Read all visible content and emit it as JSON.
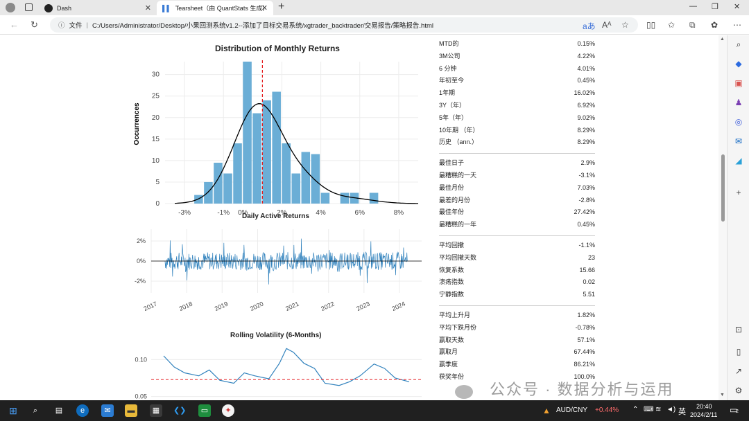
{
  "browser": {
    "tabs": [
      {
        "label": "Dash"
      },
      {
        "label": "Tearsheet（由 QuantStats 生成）"
      }
    ],
    "new_tab": "+",
    "address": {
      "prefix": "文件",
      "url": "C:/Users/Administrator/Desktop/小果回测系统v1.2--添加了目标交易系统/xgtrader_backtrader/交易报告/策略报告.html"
    }
  },
  "charts": {
    "monthly": {
      "title": "Distribution of Monthly Returns",
      "ylabel": "Occurrences",
      "yticks": [
        "0",
        "5",
        "10",
        "15",
        "20",
        "25",
        "30"
      ],
      "xticks": [
        "-3%",
        "-1%",
        "0%",
        "2%",
        "4%",
        "6%",
        "8%"
      ]
    },
    "daily": {
      "title": "Daily Active Returns",
      "yticks": [
        "2%",
        "0%",
        "-2%"
      ],
      "xticks": [
        "2017",
        "2018",
        "2019",
        "2020",
        "2021",
        "2022",
        "2023",
        "2024"
      ]
    },
    "volatility": {
      "title": "Rolling Volatility (6-Months)",
      "yticks": [
        "0.10",
        "0.05"
      ]
    }
  },
  "chart_data": [
    {
      "type": "bar",
      "title": "Distribution of Monthly Returns",
      "ylabel": "Occurrences",
      "xlabel": "",
      "x": [
        -2.5,
        -2.0,
        -1.5,
        -1.0,
        -0.5,
        0.0,
        0.5,
        1.0,
        1.5,
        2.0,
        2.5,
        3.0,
        3.5,
        4.0,
        4.5,
        5.0,
        5.5,
        6.0,
        6.5,
        7.0
      ],
      "values": [
        2,
        5,
        9.5,
        7,
        14,
        33,
        21,
        24,
        26,
        14,
        7,
        12,
        11.5,
        2.5,
        0,
        2.5,
        2.5,
        0,
        2.5,
        0
      ],
      "mean_line": 1.0,
      "ylim": [
        0,
        33
      ],
      "xlim": [
        -4,
        9
      ],
      "grid": true
    },
    {
      "type": "line",
      "title": "Daily Active Returns",
      "ylim": [
        -3,
        3
      ],
      "x_range": [
        2017,
        2024
      ],
      "grid": true
    },
    {
      "type": "line",
      "title": "Rolling Volatility (6-Months)",
      "x": [
        2017.0,
        2017.3,
        2017.6,
        2018.0,
        2018.3,
        2018.6,
        2019.0,
        2019.3,
        2019.6,
        2020.0,
        2020.3,
        2020.5,
        2020.7,
        2021.0,
        2021.3,
        2021.6,
        2022.0,
        2022.3,
        2022.6,
        2023.0,
        2023.3,
        2023.6,
        2024.0
      ],
      "values": [
        0.105,
        0.09,
        0.082,
        0.078,
        0.086,
        0.072,
        0.068,
        0.082,
        0.078,
        0.074,
        0.095,
        0.115,
        0.11,
        0.095,
        0.088,
        0.068,
        0.065,
        0.07,
        0.078,
        0.094,
        0.088,
        0.075,
        0.07
      ],
      "reference_line": 0.073,
      "ylim": [
        0.045,
        0.12
      ],
      "grid": true
    }
  ],
  "metrics": {
    "group1": [
      {
        "label": "MTD的",
        "value": "0.15%"
      },
      {
        "label": "3M公司",
        "value": "4.22%"
      },
      {
        "label": "6 分钟",
        "value": "4.01%"
      },
      {
        "label": "年初至今",
        "value": "0.45%"
      },
      {
        "label": "1年期",
        "value": "16.02%"
      },
      {
        "label": "3Y（年）",
        "value": "6.92%"
      },
      {
        "label": "5年（年）",
        "value": "9.02%"
      },
      {
        "label": "10年期 （年）",
        "value": "8.29%"
      },
      {
        "label": "历史 （ann.）",
        "value": "8.29%"
      }
    ],
    "group2": [
      {
        "label": "最佳日子",
        "value": "2.9%"
      },
      {
        "label": "最糟糕的一天",
        "value": "-3.1%"
      },
      {
        "label": "最佳月份",
        "value": "7.03%"
      },
      {
        "label": "最差的月份",
        "value": "-2.8%"
      },
      {
        "label": "最佳年份",
        "value": "27.42%"
      },
      {
        "label": "最糟糕的一年",
        "value": "0.45%"
      }
    ],
    "group3": [
      {
        "label": "平均回撤",
        "value": "-1.1%"
      },
      {
        "label": "平均回撤天数",
        "value": "23"
      },
      {
        "label": "恢复系数",
        "value": "15.66"
      },
      {
        "label": "溃疡指数",
        "value": "0.02"
      },
      {
        "label": "宁静指数",
        "value": "5.51"
      }
    ],
    "group4": [
      {
        "label": "平均上升月",
        "value": "1.82%"
      },
      {
        "label": "平均下跌月份",
        "value": "-0.78%"
      },
      {
        "label": "赢取天数",
        "value": "57.1%"
      },
      {
        "label": "赢取月",
        "value": "67.44%"
      },
      {
        "label": "赢季度",
        "value": "86.21%"
      },
      {
        "label": "获奖年份",
        "value": "100.0%"
      }
    ]
  },
  "watermark": "公众号 · 数据分析与运用",
  "taskbar": {
    "ticker": "AUD/CNY",
    "ticker_change": "+0.44%",
    "ime": "英",
    "time": "20:40",
    "date": "2024/2/11",
    "notif_count": "2"
  },
  "colors": {
    "bar": "#6baed6",
    "line": "#3182bd",
    "mean": "#e41a1c",
    "positive": "#e84a5f"
  }
}
